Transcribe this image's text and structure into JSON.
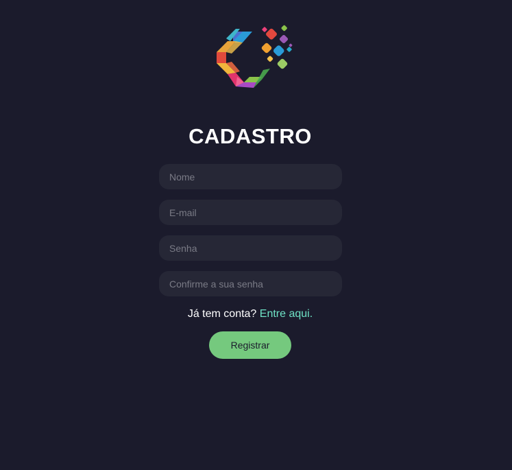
{
  "header": {
    "logo_icon": "colorful-c-logo-icon",
    "title": "CADASTRO"
  },
  "form": {
    "name_placeholder": "Nome",
    "email_placeholder": "E-mail",
    "password_placeholder": "Senha",
    "confirm_placeholder": "Confirme a sua senha",
    "login_prompt": "Já tem conta?",
    "login_link": "Entre aqui.",
    "submit_label": "Registrar"
  },
  "colors": {
    "background": "#1b1b2c",
    "input_background": "#262736",
    "link": "#6fe3c6",
    "button": "#75c97e"
  }
}
